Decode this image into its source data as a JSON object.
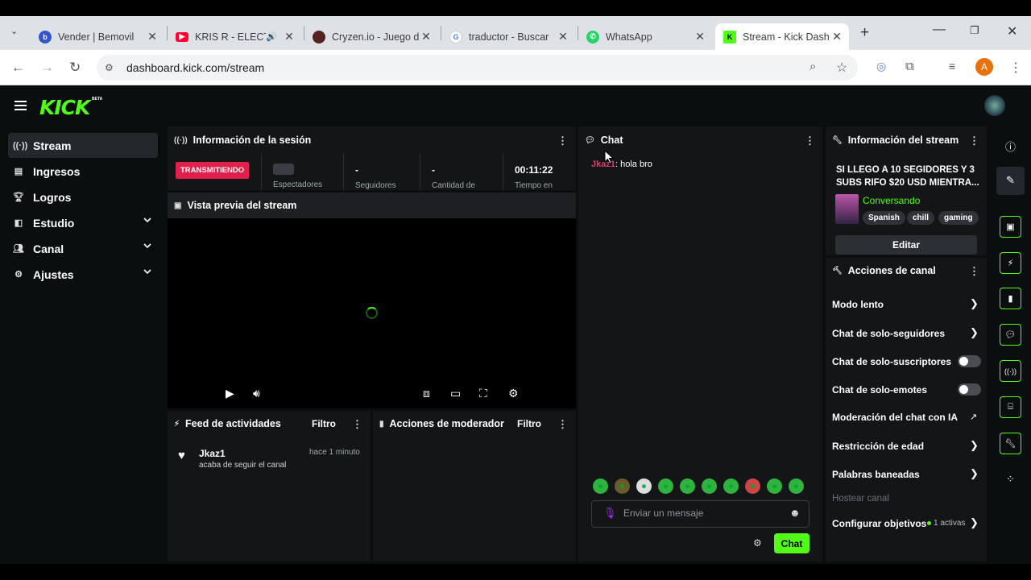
{
  "browser": {
    "tabs": [
      {
        "title": "Vender | Bemovil",
        "color": "#3355cc"
      },
      {
        "title": "KRIS R - ELECT",
        "color": "#ff0033"
      },
      {
        "title": "Cryzen.io - Juego d",
        "color": "#552222"
      },
      {
        "title": "traductor - Buscar",
        "color": "#4285f4"
      },
      {
        "title": "WhatsApp",
        "color": "#25d366"
      },
      {
        "title": "Stream - Kick Dash",
        "color": "#53fc18"
      }
    ],
    "url": "dashboard.kick.com/stream",
    "profile_initial": "A"
  },
  "app": {
    "logo": "KICK",
    "beta": "BETA",
    "sidebar": [
      {
        "label": "Stream",
        "icon": "broadcast-icon"
      },
      {
        "label": "Ingresos",
        "icon": "chart-icon"
      },
      {
        "label": "Logros",
        "icon": "trophy-icon"
      },
      {
        "label": "Estudio",
        "icon": "studio-icon"
      },
      {
        "label": "Canal",
        "icon": "users-icon"
      },
      {
        "label": "Ajustes",
        "icon": "gear-icon"
      }
    ],
    "session": {
      "title": "Información de la sesión",
      "status": "TRANSMITIENDO",
      "stats": [
        {
          "value": "",
          "label": "Espectadores"
        },
        {
          "value": "-",
          "label": "Seguidores"
        },
        {
          "value": "-",
          "label": "Cantidad de"
        },
        {
          "value": "00:11:22",
          "label": "Tiempo en"
        }
      ]
    },
    "preview": {
      "title": "Vista previa del stream"
    },
    "feed": {
      "title": "Feed de actividades",
      "filter": "Filtro",
      "user": "Jkaz1",
      "action": "acaba de seguir el canal",
      "time": "hace 1 minuto"
    },
    "modactions": {
      "title": "Acciones de moderador",
      "filter": "Filtro"
    },
    "chat": {
      "title": "Chat",
      "user": "Jkaz1",
      "message": ": hola bro",
      "placeholder": "Enviar un mensaje",
      "send": "Chat"
    },
    "streaminfo": {
      "title": "Información del stream",
      "stream_title": "SI LLEGO A 10 SEGIDORES Y 3 SUBS RIFO $20 USD MIENTRA...",
      "category": "Conversando",
      "tags": [
        "Spanish",
        "chill",
        "gaming"
      ],
      "edit": "Editar"
    },
    "channel": {
      "title": "Acciones de canal",
      "items": [
        {
          "label": "Modo lento",
          "kind": "chevron"
        },
        {
          "label": "Chat de solo-seguidores",
          "kind": "chevron"
        },
        {
          "label": "Chat de solo-suscriptores",
          "kind": "toggle"
        },
        {
          "label": "Chat de solo-emotes",
          "kind": "toggle"
        },
        {
          "label": "Moderación del chat con IA",
          "kind": "external"
        },
        {
          "label": "Restricción de edad",
          "kind": "chevron"
        },
        {
          "label": "Palabras baneadas",
          "kind": "chevron"
        },
        {
          "label": "Hostear canal",
          "kind": "disabled"
        },
        {
          "label": "Configurar objetivos",
          "kind": "chevron"
        }
      ],
      "goals_active": "1 activas"
    }
  }
}
